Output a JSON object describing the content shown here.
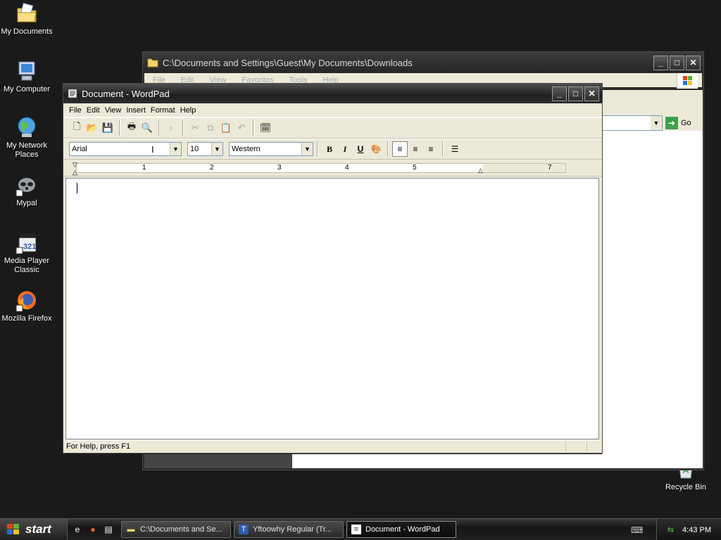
{
  "desktop": {
    "icons": [
      {
        "label": "My Documents"
      },
      {
        "label": "My Computer"
      },
      {
        "label": "My Network Places"
      },
      {
        "label": "Mypal"
      },
      {
        "label": "Media Player Classic"
      },
      {
        "label": "Mozilla Firefox"
      },
      {
        "label": "Recycle Bin"
      }
    ]
  },
  "explorer": {
    "title": "C:\\Documents and Settings\\Guest\\My Documents\\Downloads",
    "menu": [
      "File",
      "Edit",
      "View",
      "Favorites",
      "Tools",
      "Help"
    ],
    "go_label": "Go"
  },
  "wordpad": {
    "title": "Document - WordPad",
    "menu": [
      "File",
      "Edit",
      "View",
      "Insert",
      "Format",
      "Help"
    ],
    "font_name": "Arial",
    "font_size": "10",
    "script": "Western",
    "ruler_numbers": [
      "1",
      "2",
      "3",
      "4",
      "5",
      "7"
    ],
    "status": "For Help, press F1"
  },
  "taskbar": {
    "start_label": "start",
    "tasks": [
      {
        "label": "C:\\Documents and Se..."
      },
      {
        "label": "Yftoowhy Regular (Tr..."
      },
      {
        "label": "Document - WordPad"
      }
    ],
    "clock": "4:43 PM"
  },
  "colors": {
    "desktop_bg": "#1a1a1a",
    "window_face": "#ece9d8"
  }
}
